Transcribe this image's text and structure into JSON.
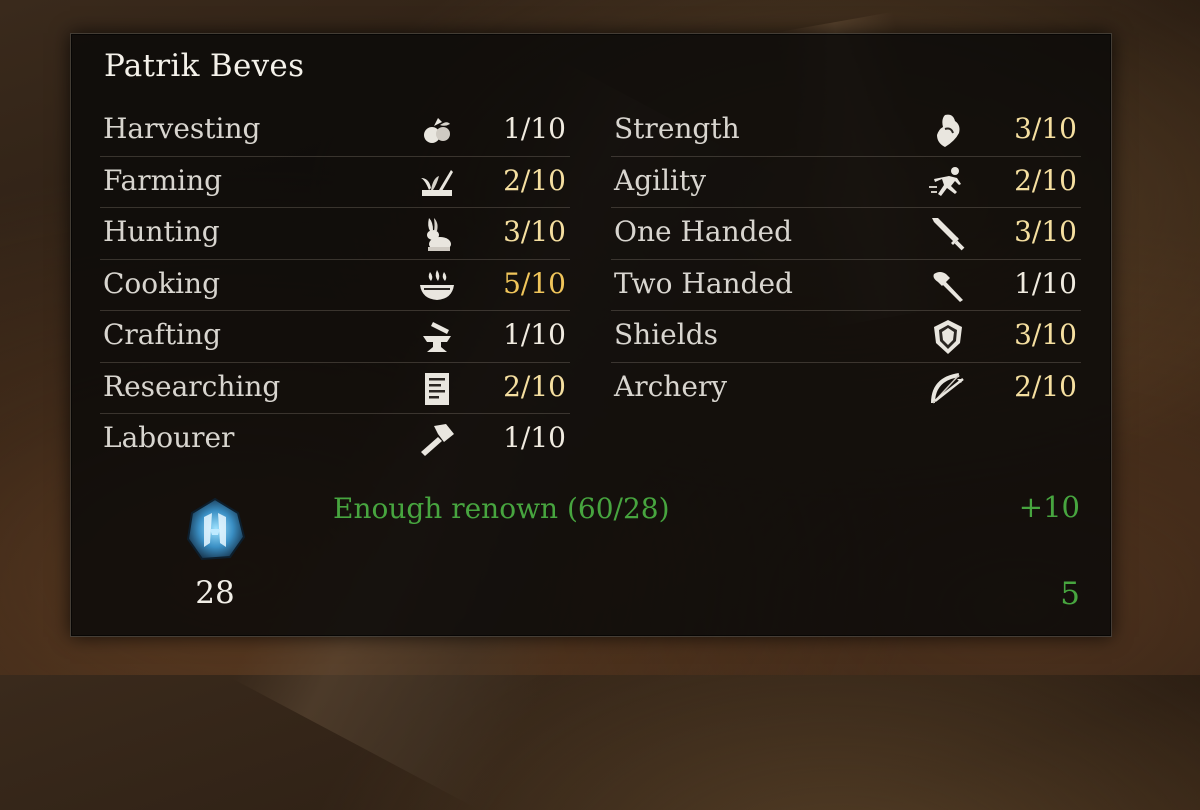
{
  "character": {
    "name": "Patrik Beves"
  },
  "skills_left": [
    {
      "label": "Harvesting",
      "value": "1/10",
      "icon": "harvest-icon",
      "color": "#f0ebe0"
    },
    {
      "label": "Farming",
      "value": "2/10",
      "icon": "farming-icon",
      "color": "#f5dfa0"
    },
    {
      "label": "Hunting",
      "value": "3/10",
      "icon": "rabbit-icon",
      "color": "#f5dfa0"
    },
    {
      "label": "Cooking",
      "value": "5/10",
      "icon": "cooking-bowl-icon",
      "color": "#f0c55a"
    },
    {
      "label": "Crafting",
      "value": "1/10",
      "icon": "anvil-icon",
      "color": "#f0ebe0"
    },
    {
      "label": "Researching",
      "value": "2/10",
      "icon": "scroll-icon",
      "color": "#f5dfa0"
    },
    {
      "label": "Labourer",
      "value": "1/10",
      "icon": "hammer-icon",
      "color": "#f0ebe0"
    }
  ],
  "skills_right": [
    {
      "label": "Strength",
      "value": "3/10",
      "icon": "strength-icon",
      "color": "#f5dfa0"
    },
    {
      "label": "Agility",
      "value": "2/10",
      "icon": "running-icon",
      "color": "#f5dfa0"
    },
    {
      "label": "One Handed",
      "value": "3/10",
      "icon": "sword-icon",
      "color": "#f5dfa0"
    },
    {
      "label": "Two Handed",
      "value": "1/10",
      "icon": "axe-icon",
      "color": "#f0ebe0"
    },
    {
      "label": "Shields",
      "value": "3/10",
      "icon": "shield-icon",
      "color": "#f5dfa0"
    },
    {
      "label": "Archery",
      "value": "2/10",
      "icon": "bow-icon",
      "color": "#f5dfa0"
    }
  ],
  "renown": {
    "message": "Enough renown (60/28)",
    "bonus": "+10",
    "cost": "28",
    "points": "5",
    "icon": "renown-crystal-icon",
    "accent_color": "#47a53f"
  }
}
